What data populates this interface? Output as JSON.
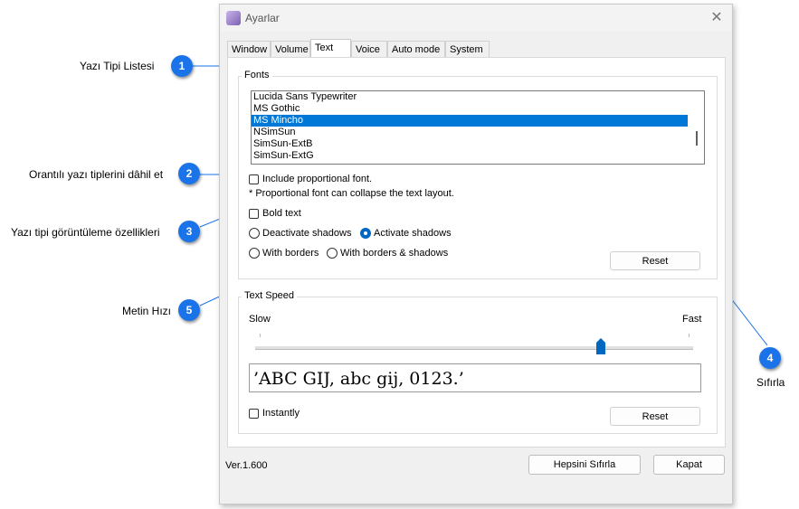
{
  "callouts": [
    {
      "number": "1",
      "label": "Yazı Tipi Listesi"
    },
    {
      "number": "2",
      "label": "Orantılı yazı tiplerini dâhil et"
    },
    {
      "number": "3",
      "label": "Yazı tipi görüntüleme özellikleri"
    },
    {
      "number": "4",
      "label": "Sıfırla"
    },
    {
      "number": "5",
      "label": "Metin Hızı"
    }
  ],
  "window": {
    "title": "Ayarlar",
    "close_symbol": "✕"
  },
  "tabs": [
    {
      "label": "Window",
      "active": false
    },
    {
      "label": "Volume",
      "active": false
    },
    {
      "label": "Text",
      "active": true
    },
    {
      "label": "Voice",
      "active": false
    },
    {
      "label": "Auto mode",
      "active": false
    },
    {
      "label": "System",
      "active": false
    }
  ],
  "fonts_group": {
    "title": "Fonts",
    "items": [
      "Lucida Sans Typewriter",
      "MS Gothic",
      "MS Mincho",
      "NSimSun",
      "SimSun-ExtB",
      "SimSun-ExtG"
    ],
    "selected": "MS Mincho",
    "include_proportional_label": "Include proportional font.",
    "include_proportional_checked": false,
    "note": "* Proportional font can collapse the text layout.",
    "bold_label": "Bold text",
    "bold_checked": false,
    "deactivate_shadows_label": "Deactivate shadows",
    "activate_shadows_label": "Activate shadows",
    "shadows_selected": "activate",
    "with_borders_label": "With borders",
    "with_borders_shadows_label": "With borders & shadows",
    "reset_label": "Reset"
  },
  "speed_group": {
    "title": "Text Speed",
    "slow_label": "Slow",
    "fast_label": "Fast",
    "speed_fraction": 0.79,
    "preview_text": "’ABC GIJ, abc gij, 0123.’",
    "instantly_label": "Instantly",
    "instantly_checked": false,
    "reset_label": "Reset"
  },
  "footer": {
    "version": "Ver.1.600",
    "reset_all_label": "Hepsini Sıfırla",
    "close_label": "Kapat"
  },
  "colors": {
    "accent": "#0078d7",
    "badge": "#1a73e8",
    "callout_line": "#1a73e8"
  },
  "icons": {
    "app": "app-icon",
    "close": "close-icon"
  }
}
